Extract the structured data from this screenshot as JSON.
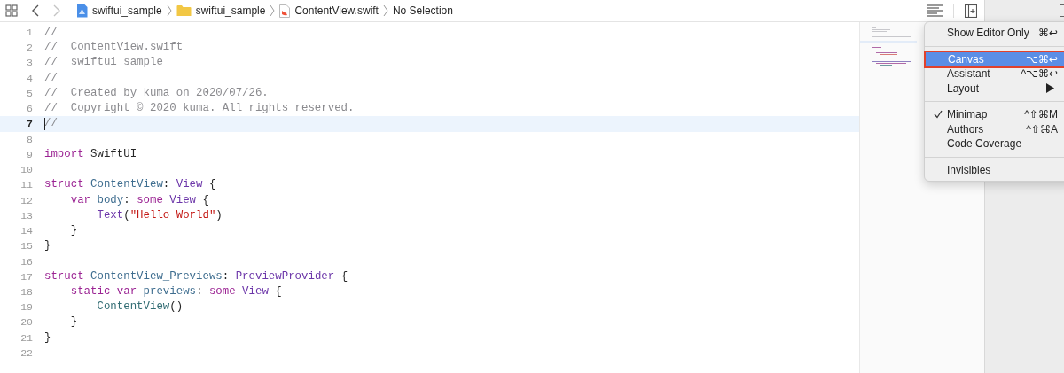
{
  "toolbar": {
    "back_enabled": true,
    "forward_enabled": false
  },
  "breadcrumbs": [
    {
      "kind": "project",
      "label": "swiftui_sample"
    },
    {
      "kind": "folder",
      "label": "swiftui_sample"
    },
    {
      "kind": "file",
      "label": "ContentView.swift"
    },
    {
      "kind": "plain",
      "label": "No Selection"
    }
  ],
  "editor": {
    "lines": [
      {
        "number": "1",
        "current": false,
        "tokens": [
          {
            "kind": "comment",
            "text": "//"
          }
        ]
      },
      {
        "number": "2",
        "current": false,
        "tokens": [
          {
            "kind": "comment",
            "text": "//  ContentView.swift"
          }
        ]
      },
      {
        "number": "3",
        "current": false,
        "tokens": [
          {
            "kind": "comment",
            "text": "//  swiftui_sample"
          }
        ]
      },
      {
        "number": "4",
        "current": false,
        "tokens": [
          {
            "kind": "comment",
            "text": "//"
          }
        ]
      },
      {
        "number": "5",
        "current": false,
        "tokens": [
          {
            "kind": "comment",
            "text": "//  Created by kuma on 2020/07/26."
          }
        ]
      },
      {
        "number": "6",
        "current": false,
        "tokens": [
          {
            "kind": "comment",
            "text": "//  Copyright © 2020 kuma. All rights reserved."
          }
        ]
      },
      {
        "number": "7",
        "current": true,
        "tokens": [
          {
            "kind": "comment",
            "text": "//"
          }
        ]
      },
      {
        "number": "8",
        "current": false
      },
      {
        "number": "9",
        "current": false,
        "tokens": [
          {
            "kind": "keyword",
            "text": "import"
          },
          {
            "kind": "plain",
            "text": " SwiftUI"
          }
        ]
      },
      {
        "number": "10",
        "current": false
      },
      {
        "number": "11",
        "current": false,
        "tokens": [
          {
            "kind": "keyword",
            "text": "struct"
          },
          {
            "kind": "decl",
            "text": " ContentView"
          },
          {
            "kind": "plain",
            "text": ": "
          },
          {
            "kind": "type",
            "text": "View"
          },
          {
            "kind": "plain",
            "text": " {"
          }
        ]
      },
      {
        "number": "12",
        "current": false,
        "tokens": [
          {
            "kind": "keyword",
            "text": "    var"
          },
          {
            "kind": "decl",
            "text": " body"
          },
          {
            "kind": "plain",
            "text": ": "
          },
          {
            "kind": "keyword",
            "text": "some"
          },
          {
            "kind": "type",
            "text": " View"
          },
          {
            "kind": "plain",
            "text": " {"
          }
        ]
      },
      {
        "number": "13",
        "current": false,
        "tokens": [
          {
            "kind": "type",
            "text": "        Text"
          },
          {
            "kind": "plain",
            "text": "("
          },
          {
            "kind": "string",
            "text": "\"Hello World\""
          },
          {
            "kind": "plain",
            "text": ")"
          }
        ]
      },
      {
        "number": "14",
        "current": false,
        "tokens": [
          {
            "kind": "plain",
            "text": "    }"
          }
        ]
      },
      {
        "number": "15",
        "current": false,
        "tokens": [
          {
            "kind": "plain",
            "text": "}"
          }
        ]
      },
      {
        "number": "16",
        "current": false
      },
      {
        "number": "17",
        "current": false,
        "tokens": [
          {
            "kind": "keyword",
            "text": "struct"
          },
          {
            "kind": "decl",
            "text": " ContentView_Previews"
          },
          {
            "kind": "plain",
            "text": ": "
          },
          {
            "kind": "type",
            "text": "PreviewProvider"
          },
          {
            "kind": "plain",
            "text": " {"
          }
        ]
      },
      {
        "number": "18",
        "current": false,
        "tokens": [
          {
            "kind": "keyword",
            "text": "    static var"
          },
          {
            "kind": "decl",
            "text": " previews"
          },
          {
            "kind": "plain",
            "text": ": "
          },
          {
            "kind": "keyword",
            "text": "some"
          },
          {
            "kind": "type",
            "text": " View"
          },
          {
            "kind": "plain",
            "text": " {"
          }
        ]
      },
      {
        "number": "19",
        "current": false,
        "tokens": [
          {
            "kind": "call",
            "text": "        ContentView"
          },
          {
            "kind": "plain",
            "text": "()"
          }
        ]
      },
      {
        "number": "20",
        "current": false,
        "tokens": [
          {
            "kind": "plain",
            "text": "    }"
          }
        ]
      },
      {
        "number": "21",
        "current": false,
        "tokens": [
          {
            "kind": "plain",
            "text": "}"
          }
        ]
      },
      {
        "number": "22",
        "current": false
      }
    ]
  },
  "menu": {
    "items": [
      {
        "kind": "item",
        "label": "Show Editor Only",
        "shortcut": "⌘↩",
        "selected": false,
        "checked": false,
        "submenu": false,
        "outlined": false
      },
      {
        "kind": "separator"
      },
      {
        "kind": "item",
        "label": "Canvas",
        "shortcut": "⌥⌘↩",
        "selected": true,
        "checked": false,
        "submenu": false,
        "outlined": true
      },
      {
        "kind": "item",
        "label": "Assistant",
        "shortcut": "^⌥⌘↩",
        "selected": false,
        "checked": false,
        "submenu": false,
        "outlined": false
      },
      {
        "kind": "item",
        "label": "Layout",
        "selected": false,
        "checked": false,
        "submenu": true,
        "outlined": false
      },
      {
        "kind": "separator"
      },
      {
        "kind": "item",
        "label": "Minimap",
        "shortcut": "^⇧⌘M",
        "selected": false,
        "checked": true,
        "submenu": false,
        "outlined": false
      },
      {
        "kind": "item",
        "label": "Authors",
        "shortcut": "^⇧⌘A",
        "selected": false,
        "checked": false,
        "submenu": false,
        "outlined": false
      },
      {
        "kind": "item",
        "label": "Code Coverage",
        "selected": false,
        "checked": false,
        "submenu": false,
        "outlined": false
      },
      {
        "kind": "separator"
      },
      {
        "kind": "item",
        "label": "Invisibles",
        "selected": false,
        "checked": false,
        "submenu": false,
        "outlined": false
      }
    ]
  }
}
